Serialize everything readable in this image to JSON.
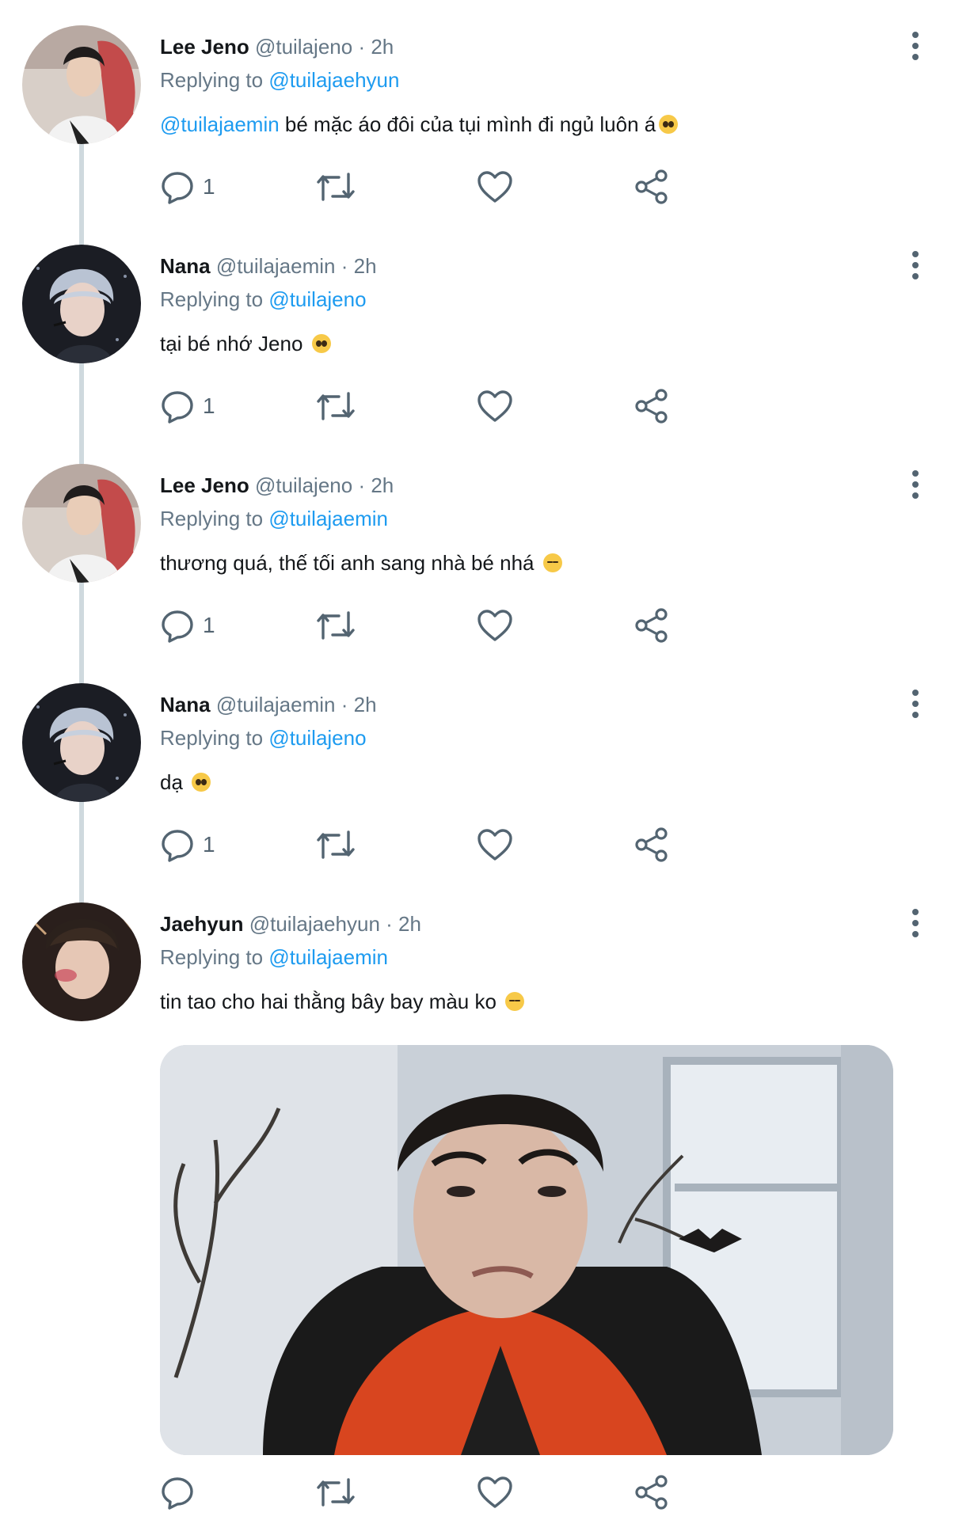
{
  "theme": {
    "mention_color": "#1d9bf0",
    "meta_color": "#657786",
    "icon_color": "#536471",
    "thread_line_color": "#cfd9de"
  },
  "tweets": [
    {
      "name": "Lee Jeno",
      "handle": "@tuilajeno",
      "time": "· 2h",
      "replying_prefix": "Replying to",
      "replying_to": "@tuilajaehyun",
      "mention": "@tuilajaemin",
      "text": " bé mặc áo đôi của tụi mình đi ngủ luôn á",
      "emoji": "pleading-face",
      "reply_count": "1",
      "avatar": "avatar-lee-jeno"
    },
    {
      "name": "Nana",
      "handle": "@tuilajaemin",
      "time": "· 2h",
      "replying_prefix": "Replying to",
      "replying_to": "@tuilajeno",
      "text": "tại bé nhớ Jeno",
      "emoji": "pleading-face",
      "reply_count": "1",
      "avatar": "avatar-nana"
    },
    {
      "name": "Lee Jeno",
      "handle": "@tuilajeno",
      "time": "· 2h",
      "replying_prefix": "Replying to",
      "replying_to": "@tuilajaemin",
      "text": "thương quá, thế tối anh sang nhà bé nhá",
      "emoji": "pensive-face",
      "reply_count": "1",
      "avatar": "avatar-lee-jeno"
    },
    {
      "name": "Nana",
      "handle": "@tuilajaemin",
      "time": "· 2h",
      "replying_prefix": "Replying to",
      "replying_to": "@tuilajeno",
      "text": "dạ",
      "emoji": "pleading-face",
      "reply_count": "1",
      "avatar": "avatar-nana"
    },
    {
      "name": "Jaehyun",
      "handle": "@tuilajaehyun",
      "time": "· 2h",
      "replying_prefix": "Replying to",
      "replying_to": "@tuilajaemin",
      "text": "tin tao cho hai thằng bây bay màu ko",
      "emoji": "pensive-face",
      "reply_count": "",
      "avatar": "avatar-jaehyun",
      "media": "photo-attachment"
    }
  ]
}
